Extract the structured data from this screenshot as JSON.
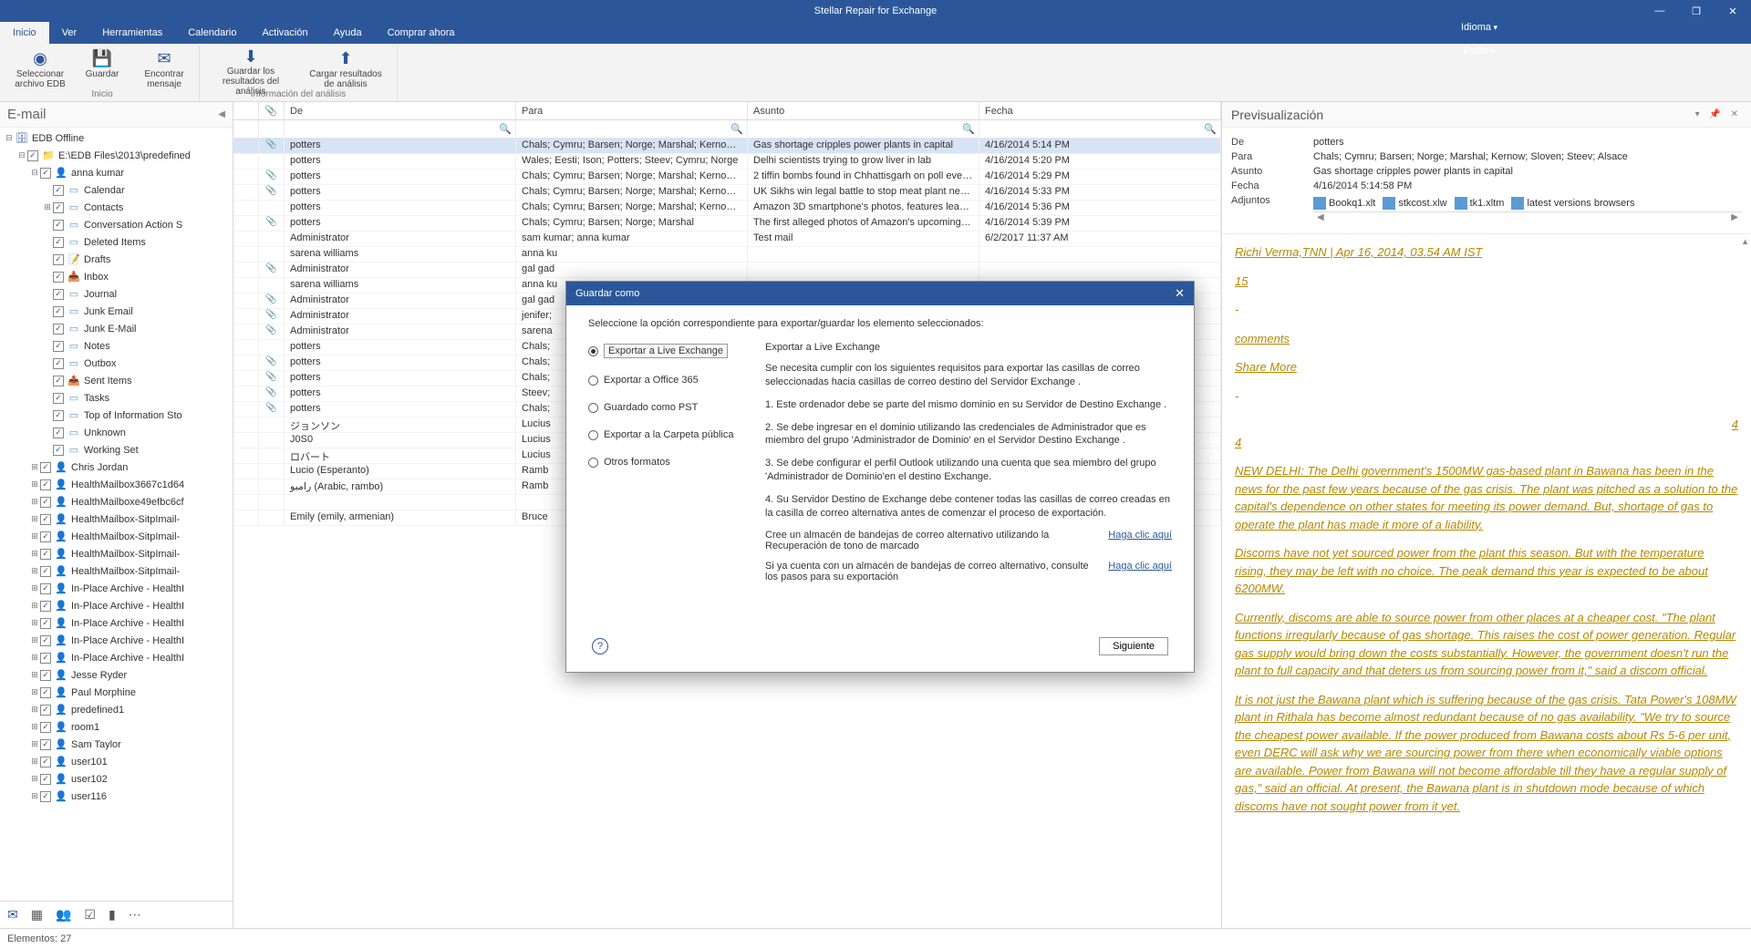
{
  "app": {
    "title": "Stellar Repair for Exchange"
  },
  "window_ctrls": {
    "min": "—",
    "max": "❐",
    "close": "✕"
  },
  "menu": {
    "tabs": [
      "Inicio",
      "Ver",
      "Herramientas",
      "Calendario",
      "Activación",
      "Ayuda",
      "Comprar ahora"
    ],
    "right": {
      "idioma": "Idioma",
      "estilo": "Estilo"
    }
  },
  "ribbon": {
    "group1": {
      "label": "Inicio",
      "buttons": [
        {
          "label": "Seleccionar\narchivo EDB"
        },
        {
          "label": "Guardar"
        },
        {
          "label": "Encontrar\nmensaje"
        }
      ]
    },
    "group2": {
      "label": "Información del análisis",
      "buttons": [
        {
          "label": "Guardar los\nresultados del análisis"
        },
        {
          "label": "Cargar resultados\nde análisis"
        }
      ]
    }
  },
  "left": {
    "title": "E-mail",
    "root": {
      "label": "EDB Offline"
    },
    "path": {
      "label": "E:\\EDB Files\\2013\\predefined"
    },
    "mailbox": {
      "label": "anna kumar"
    },
    "folders": [
      "Calendar",
      "Contacts",
      "Conversation Action S",
      "Deleted Items",
      "Drafts",
      "Inbox",
      "Journal",
      "Junk Email",
      "Junk E-Mail",
      "Notes",
      "Outbox",
      "Sent Items",
      "Tasks",
      "Top of Information Sto",
      "Unknown",
      "Working Set"
    ],
    "mailboxes": [
      "Chris Jordan",
      "HealthMailbox3667c1d64",
      "HealthMailboxe49efbc6cf",
      "HealthMailbox-SitpImail-",
      "HealthMailbox-SitpImail-",
      "HealthMailbox-SitpImail-",
      "HealthMailbox-SitpImail-",
      "In-Place Archive - HealthI",
      "In-Place Archive - HealthI",
      "In-Place Archive - HealthI",
      "In-Place Archive - HealthI",
      "In-Place Archive - HealthI",
      "Jesse Ryder",
      "Paul Morphine",
      "predefined1",
      "room1",
      "Sam Taylor",
      "user101",
      "user102",
      "user116"
    ]
  },
  "grid": {
    "headers": {
      "de": "De",
      "para": "Para",
      "asunto": "Asunto",
      "fecha": "Fecha"
    },
    "rows": [
      {
        "att": "📎",
        "de": "potters",
        "para": "Chals; Cymru; Barsen; Norge; Marshal; Kernow; Sl...",
        "asunto": "Gas shortage cripples power plants in capital",
        "fecha": "4/16/2014 5:14 PM",
        "sel": true
      },
      {
        "att": "",
        "de": "potters",
        "para": "Wales; Eesti; Ison; Potters; Steev; Cymru; Norge",
        "asunto": "Delhi scientists trying to grow liver in lab",
        "fecha": "4/16/2014 5:20 PM"
      },
      {
        "att": "📎",
        "de": "potters",
        "para": "Chals; Cymru; Barsen; Norge; Marshal; Kernow; Sl...",
        "asunto": "2 tiffin bombs found in Chhattisgarh on poll eve; 2 ...",
        "fecha": "4/16/2014 5:29 PM"
      },
      {
        "att": "📎",
        "de": "potters",
        "para": "Chals; Cymru; Barsen; Norge; Marshal; Kernow; Sl...",
        "asunto": "UK Sikhs win legal battle to stop meat plant near h...",
        "fecha": "4/16/2014 5:33 PM"
      },
      {
        "att": "",
        "de": "potters",
        "para": "Chals; Cymru; Barsen; Norge; Marshal; Kernow; Sl...",
        "asunto": "Amazon 3D smartphone's photos, features leaked",
        "fecha": "4/16/2014 5:36 PM"
      },
      {
        "att": "📎",
        "de": "potters",
        "para": "Chals; Cymru; Barsen; Norge; Marshal",
        "asunto": "The first alleged photos of Amazon's upcoming sm...",
        "fecha": "4/16/2014 5:39 PM"
      },
      {
        "att": "",
        "de": "Administrator",
        "para": "sam kumar; anna kumar",
        "asunto": "Test mail",
        "fecha": "6/2/2017 11:37 AM"
      },
      {
        "att": "",
        "de": "sarena williams",
        "para": "anna ku",
        "asunto": "",
        "fecha": ""
      },
      {
        "att": "📎",
        "de": "Administrator",
        "para": "gal gad",
        "asunto": "",
        "fecha": ""
      },
      {
        "att": "",
        "de": "sarena williams",
        "para": "anna ku",
        "asunto": "",
        "fecha": ""
      },
      {
        "att": "📎",
        "de": "Administrator",
        "para": "gal gad",
        "asunto": "",
        "fecha": ""
      },
      {
        "att": "📎",
        "de": "Administrator",
        "para": "jenifer;",
        "asunto": "",
        "fecha": ""
      },
      {
        "att": "📎",
        "de": "Administrator",
        "para": "sarena",
        "asunto": "",
        "fecha": ""
      },
      {
        "att": "",
        "de": "potters",
        "para": "Chals;",
        "asunto": "",
        "fecha": ""
      },
      {
        "att": "📎",
        "de": "potters",
        "para": "Chals;",
        "asunto": "",
        "fecha": ""
      },
      {
        "att": "📎",
        "de": "potters",
        "para": "Chals;",
        "asunto": "",
        "fecha": ""
      },
      {
        "att": "📎",
        "de": "potters",
        "para": "Steev;",
        "asunto": "",
        "fecha": ""
      },
      {
        "att": "📎",
        "de": "potters",
        "para": "Chals;",
        "asunto": "",
        "fecha": ""
      },
      {
        "att": "",
        "de": "ジョンソン",
        "para": "Lucius",
        "asunto": "",
        "fecha": ""
      },
      {
        "att": "",
        "de": "J0S0",
        "para": "Lucius",
        "asunto": "",
        "fecha": ""
      },
      {
        "att": "",
        "de": "ロバート",
        "para": "Lucius",
        "asunto": "",
        "fecha": ""
      },
      {
        "att": "",
        "de": "Lucio (Esperanto)",
        "para": "Ramb",
        "asunto": "",
        "fecha": ""
      },
      {
        "att": "",
        "de": "رامبو (Arabic, rambo)",
        "para": "Ramb",
        "asunto": "",
        "fecha": ""
      },
      {
        "att": "",
        "de": "",
        "para": "",
        "asunto": "",
        "fecha": ""
      },
      {
        "att": "",
        "de": "Emily (emily, armenian)",
        "para": "Bruce",
        "asunto": "",
        "fecha": ""
      }
    ]
  },
  "preview": {
    "title": "Previsualización",
    "fields": {
      "de_lbl": "De",
      "de": "potters",
      "para_lbl": "Para",
      "para": "Chals; Cymru; Barsen; Norge; Marshal; Kernow; Sloven; Steev; Alsace",
      "asunto_lbl": "Asunto",
      "asunto": "Gas shortage cripples power plants in capital",
      "fecha_lbl": "Fecha",
      "fecha": "4/16/2014 5:14:58 PM",
      "adj_lbl": "Adjuntos"
    },
    "attachments": [
      "Bookq1.xlt",
      "stkcost.xlw",
      "tk1.xltm",
      "latest versions browsers"
    ],
    "body": {
      "byline": "Richi Verma,TNN | Apr 16, 2014, 03.54 AM IST",
      "n1": "15",
      "dash1": "-",
      "comments": "comments",
      "share": "Share More",
      "dash2": "-",
      "n2": "4",
      "p1": "NEW DELHI: The Delhi government's 1500MW gas-based plant in Bawana has been in the news for the past few years because of the gas crisis. The plant was pitched as a solution to the capital's dependence on other states for meeting its power demand. But, shortage of gas to operate the plant has made it more of a liability.",
      "p2": "Discoms have not yet sourced power from the plant this season. But with the temperature rising, they may be left with no choice. The peak demand this year is expected to be about 6200MW.",
      "p3": "Currently, discoms are able to source power from other places at a cheaper cost. \"The plant functions irregularly because of gas shortage. This raises the cost of power generation. Regular gas supply would bring down the costs substantially. However, the government doesn't run the plant to full capacity and that deters us from sourcing power from it,\" said a discom official.",
      "p4": "It is not just the Bawana plant which is suffering because of the gas crisis. Tata Power's 108MW plant in Rithala has become almost redundant because of no gas availability. \"We try to source the cheapest power available. If the power produced from Bawana costs about Rs 5-6 per unit, even DERC will ask why we are sourcing power from there when economically viable options are available. Power from Bawana will not become affordable till they have a regular supply of gas,\" said an official. At present, the Bawana plant is in shutdown mode because of which discoms have not sought power from it yet.",
      "side4": "4"
    }
  },
  "dialog": {
    "title": "Guardar como",
    "instr": "Seleccione la opción correspondiente para exportar/guardar los elemento seleccionados:",
    "options": [
      "Exportar a Live Exchange",
      "Exportar a Office 365",
      "Guardado como PST",
      "Exportar a la Carpeta pública",
      "Otros formatos"
    ],
    "right_title": "Exportar a Live Exchange",
    "right_intro": "Se necesita cumplir con los siguientes requisitos para exportar las casillas de correo seleccionadas hacia casillas de correo destino del Servidor Exchange .",
    "steps": [
      "1. Este ordenador debe se parte del mismo dominio en su Servidor de Destino Exchange .",
      "2. Se debe ingresar en el dominio utilizando las credenciales de Administrador  que es miembro del grupo 'Administrador de Dominio' en el Servidor Destino Exchange .",
      "3. Se debe configurar el perfil  Outlook utilizando una cuenta que sea miembro del  grupo 'Administrador de Dominio'en el destino Exchange.",
      "4. Su Servidor Destino de Exchange debe contener todas las casillas de correo creadas en la casilla de correo alternativa antes de comenzar el proceso de exportación."
    ],
    "link1_text": "Cree un almacén de bandejas de correo alternativo utilizando la Recuperación de tono de marcado",
    "link2_text": "Si ya cuenta con un almacén de bandejas de correo alternativo, consulte los pasos para su exportación",
    "link_label": "Haga clic aquí",
    "next": "Siguiente"
  },
  "status": {
    "elementos": "Elementos: 27"
  }
}
